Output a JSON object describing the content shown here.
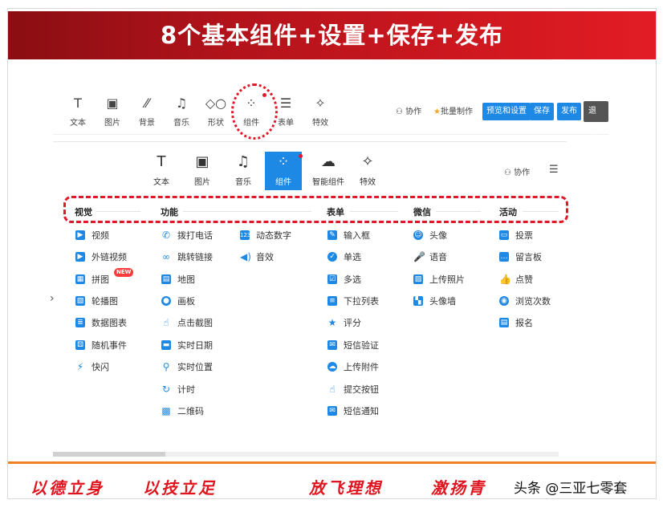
{
  "banner": {
    "title": "8个基本组件+设置+保存+发布"
  },
  "toolbar1": {
    "items": [
      {
        "label": "文本",
        "icon": "text-icon"
      },
      {
        "label": "图片",
        "icon": "image-icon"
      },
      {
        "label": "背景",
        "icon": "background-icon"
      },
      {
        "label": "音乐",
        "icon": "music-icon"
      },
      {
        "label": "形状",
        "icon": "shape-icon"
      },
      {
        "label": "组件",
        "icon": "component-icon"
      },
      {
        "label": "表单",
        "icon": "form-icon"
      },
      {
        "label": "特效",
        "icon": "effects-icon"
      }
    ],
    "collab": "协作",
    "batch": "批量制作",
    "preview": "预览和设置",
    "save": "保存",
    "publish": "发布",
    "exit": "退出"
  },
  "toolbar2": {
    "items": [
      {
        "label": "文本",
        "icon": "text-icon"
      },
      {
        "label": "图片",
        "icon": "image-icon"
      },
      {
        "label": "音乐",
        "icon": "music-icon"
      },
      {
        "label": "组件",
        "icon": "component-icon"
      },
      {
        "label": "智能组件",
        "icon": "ai-component-icon"
      },
      {
        "label": "特效",
        "icon": "effects-icon"
      }
    ],
    "collab": "协作"
  },
  "categories": [
    "视觉",
    "功能",
    "表单",
    "微信",
    "活动"
  ],
  "visual": [
    "视频",
    "外链视频",
    "拼图",
    "轮播图",
    "数据图表",
    "随机事件",
    "快闪"
  ],
  "new_badge": "NEW",
  "func_col1": [
    "拨打电话",
    "跳转链接",
    "地图",
    "画板",
    "点击截图",
    "实时日期",
    "实时位置",
    "计时",
    "二维码"
  ],
  "func_col2": [
    "动态数字",
    "音效"
  ],
  "form": [
    "输入框",
    "单选",
    "多选",
    "下拉列表",
    "评分",
    "短信验证",
    "上传附件",
    "提交按钮",
    "短信通知"
  ],
  "wechat": [
    "头像",
    "语音",
    "上传照片",
    "头像墙"
  ],
  "activity": [
    "投票",
    "留言板",
    "点赞",
    "浏览次数",
    "报名"
  ],
  "slogans": [
    "以德立身",
    "以技立足",
    "放飞理想",
    "激扬青"
  ],
  "watermark": "头条 @三亚七零套",
  "colors": {
    "brand_red": "#e0182a",
    "accent_blue": "#1e88e5",
    "orange": "#f08021"
  }
}
